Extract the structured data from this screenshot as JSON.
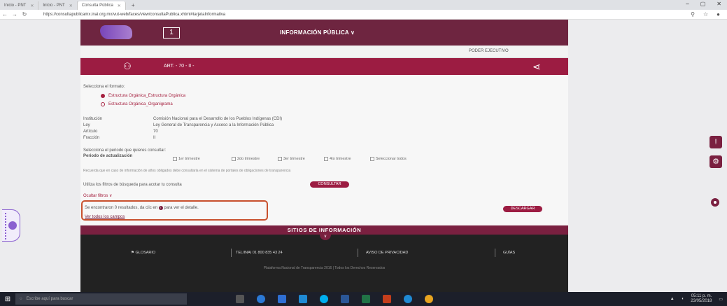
{
  "browser": {
    "tabs": [
      {
        "label": "Inicio - PNT",
        "active": false
      },
      {
        "label": "Inicio - PNT",
        "active": false
      },
      {
        "label": "Consulta Pública",
        "active": true
      }
    ],
    "new_tab": "+",
    "window_controls": [
      "–",
      "▢",
      "✕"
    ],
    "url": "https://consultapublicamx.inai.org.mx/vut-web/faces/view/consultaPublica.xhtml#tarjetaInformativa"
  },
  "header": {
    "badge": "1",
    "title": "INFORMACIÓN PÚBLICA ∨",
    "poder": "PODER EJECUTIVO"
  },
  "article": {
    "label": "ART. - 70 - II -",
    "share_icon": "share-icon"
  },
  "form": {
    "select_format_label": "Selecciona el formato:",
    "format_options": [
      {
        "label": "Estructura Orgánica_Estructura Orgánica",
        "selected": true
      },
      {
        "label": "Estructura Orgánica_Organigrama",
        "selected": false
      }
    ],
    "info": [
      {
        "key": "Institución",
        "value": "Comisión Nacional para el Desarrollo de los Pueblos Indígenas (CDI)"
      },
      {
        "key": "Ley",
        "value": "Ley General de Transparencia y Acceso a la Información Pública"
      },
      {
        "key": "Artículo",
        "value": "70"
      },
      {
        "key": "Fracción",
        "value": "II"
      }
    ],
    "period_prompt": "Selecciona el periodo que quieres consultar:",
    "period_label": "Periodo de actualización",
    "period_options": [
      "1er trimestre",
      "2do trimestre",
      "3er trimestre",
      "4to trimestre",
      "Seleccionar todos"
    ],
    "notice": "Recuerda que en caso de información de años obligados debe consultarla en el sistema de portales de obligaciones de transparencia",
    "filter_hint": "Utiliza los filtros de búsqueda para acotar tu consulta",
    "consultar_label": "CONSULTAR",
    "hide_filters_label": "Ocultar filtros ∨",
    "results_text": "Se encontraron 0 resultados, da clic en",
    "results_text_after": "para ver el detalle.",
    "view_all_label": "Ver todos los campos",
    "download_label": "DESCARGAR"
  },
  "footer": {
    "sitios_label": "SITIOS DE INFORMACIÓN",
    "items": [
      "GLOSARIO",
      "TEL/INAI 01 800 835 43 24",
      "AVISO DE PRIVACIDAD",
      "GUÍAS"
    ],
    "copyright": "Plataforma Nacional de Transparencia 2016 | Todos los Derechos Reservados"
  },
  "taskbar": {
    "search_placeholder": "Escribe aquí para buscar",
    "time": "05:11 p. m.",
    "date": "23/05/2018"
  },
  "colors": {
    "header": "#6e2540",
    "accent": "#9c1c42",
    "highlight_box": "#c8502d"
  }
}
